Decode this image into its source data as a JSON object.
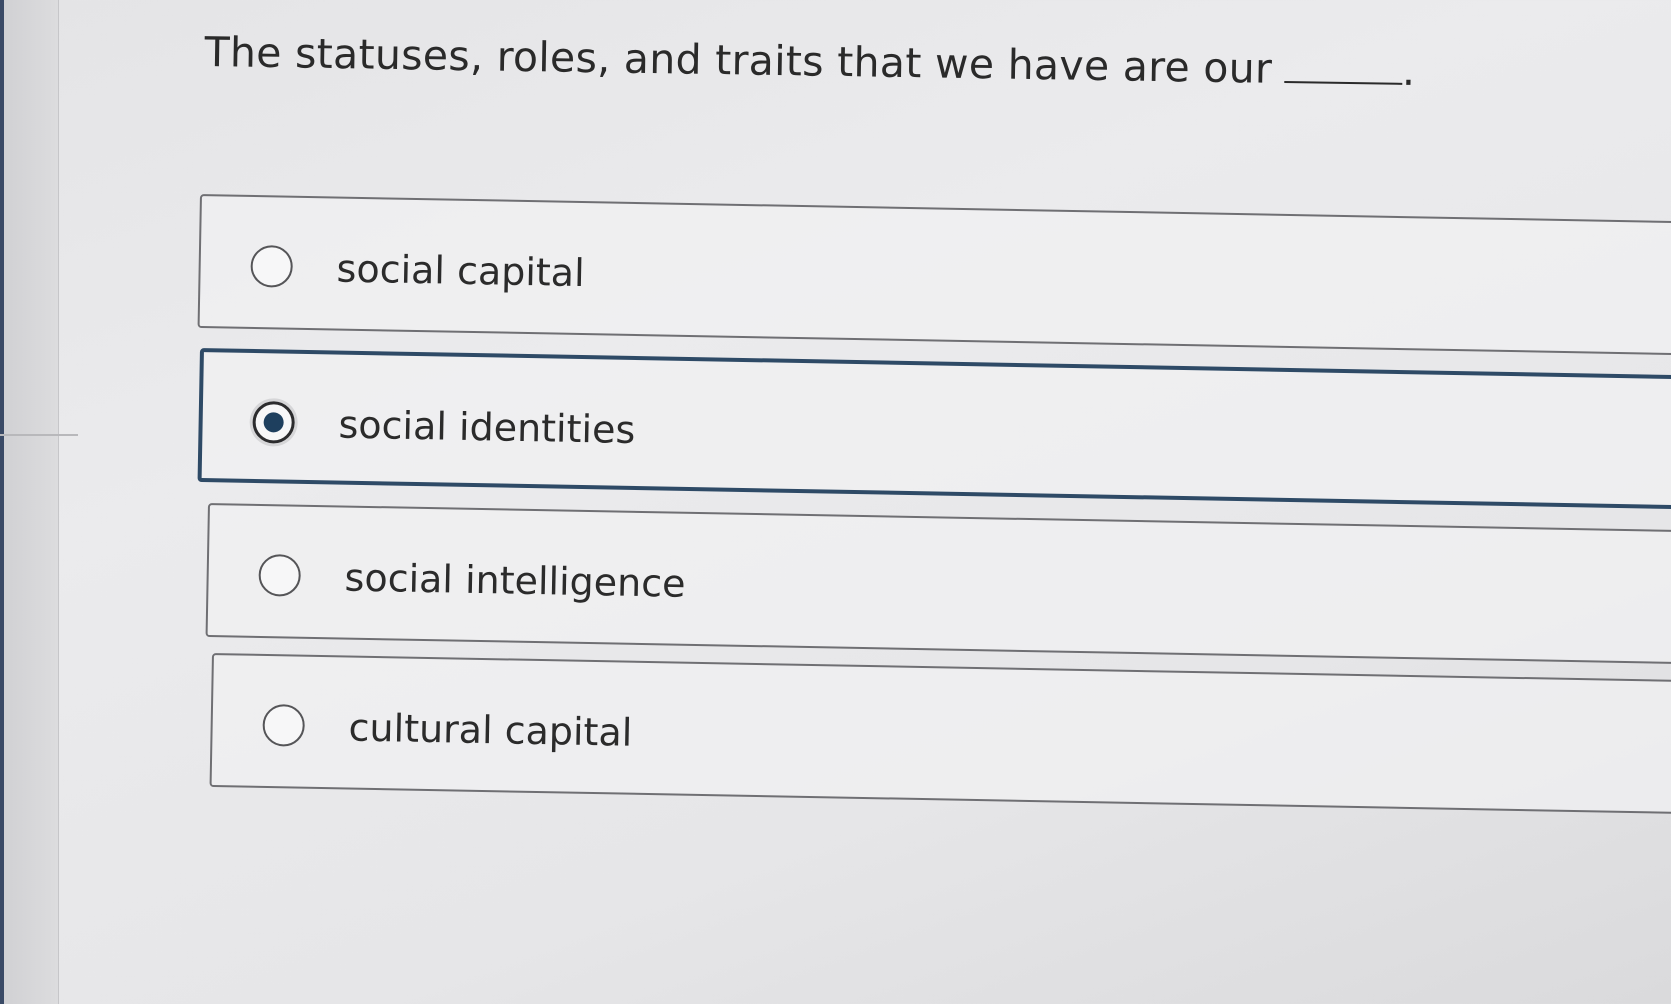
{
  "question": {
    "text": "The statuses, roles, and traits that we have are our",
    "end_punct": "."
  },
  "options": [
    {
      "label": "social capital",
      "selected": false
    },
    {
      "label": "social identities",
      "selected": true
    },
    {
      "label": "social intelligence",
      "selected": false
    },
    {
      "label": "cultural capital",
      "selected": false
    }
  ],
  "colors": {
    "selected_border": "#2e4a66",
    "radio_fill": "#1e3f5e",
    "accent_strip": "#3a4a66"
  }
}
